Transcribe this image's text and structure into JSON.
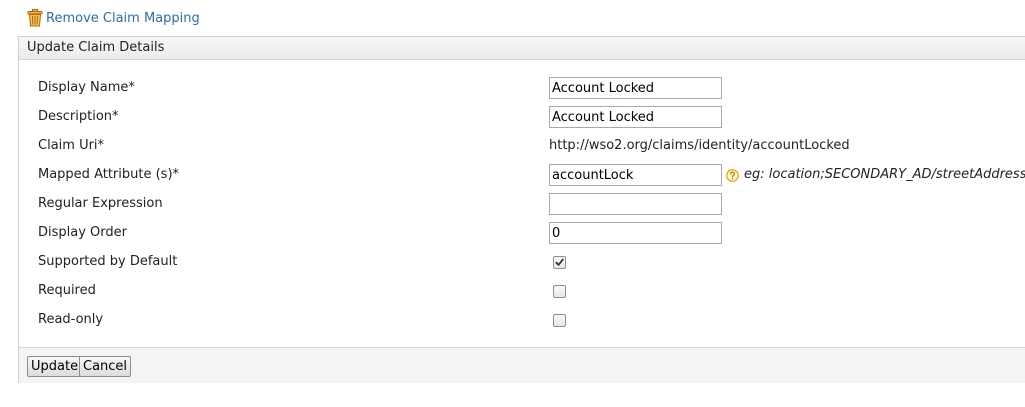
{
  "actions": {
    "remove_label": "Remove Claim Mapping"
  },
  "panel": {
    "title": "Update Claim Details"
  },
  "fields": {
    "display_name": {
      "label": "Display Name*",
      "value": "Account Locked"
    },
    "description": {
      "label": "Description*",
      "value": "Account Locked"
    },
    "claim_uri": {
      "label": "Claim Uri*",
      "value": "http://wso2.org/claims/identity/accountLocked"
    },
    "mapped_attribute": {
      "label": "Mapped Attribute (s)*",
      "value": "accountLock",
      "hint": "eg: location;SECONDARY_AD/streetAddress"
    },
    "regular_expression": {
      "label": "Regular Expression",
      "value": ""
    },
    "display_order": {
      "label": "Display Order",
      "value": "0"
    },
    "supported_by_default": {
      "label": "Supported by Default",
      "checked": true
    },
    "required": {
      "label": "Required",
      "checked": false
    },
    "read_only": {
      "label": "Read-only",
      "checked": false
    }
  },
  "buttons": {
    "update_label": "Update",
    "cancel_label": "Cancel"
  },
  "icons": {
    "remove": "trash-icon",
    "help": "help-icon"
  },
  "colors": {
    "link": "#2f6ea6",
    "help_icon": "#e0a400"
  }
}
